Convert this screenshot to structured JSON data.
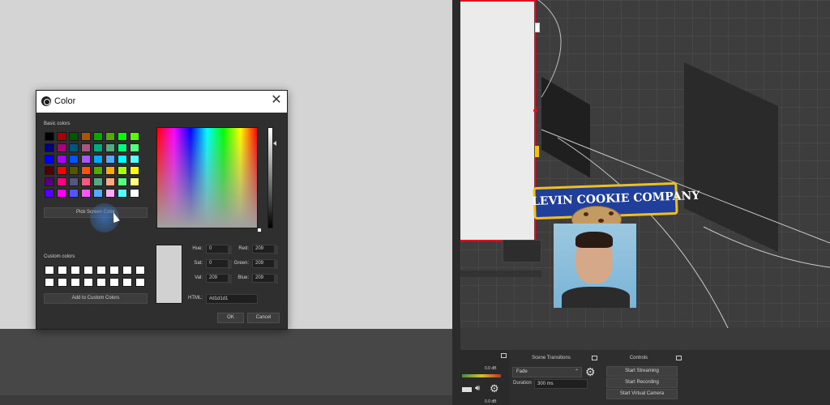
{
  "dialog": {
    "title": "Color",
    "close_glyph": "✕",
    "basic_colors_label": "Basic colors",
    "pick_screen_color_label": "Pick Screen Color",
    "custom_colors_label": "Custom colors",
    "add_to_custom_label": "Add to Custom Colors",
    "fields": {
      "hue_label": "Hue:",
      "hue_value": "0",
      "sat_label": "Sat:",
      "sat_value": "0",
      "val_label": "Val:",
      "val_value": "209",
      "red_label": "Red:",
      "red_value": "209",
      "green_label": "Green:",
      "green_value": "209",
      "blue_label": "Blue:",
      "blue_value": "209",
      "html_label": "HTML:",
      "html_value": "#d1d1d1"
    },
    "ok_label": "OK",
    "cancel_label": "Cancel",
    "current_color": "#d1d1d1",
    "basic_colors": [
      "#000000",
      "#aa0000",
      "#005500",
      "#aa5500",
      "#00aa00",
      "#55aa00",
      "#00ff00",
      "#55ff00",
      "#00007f",
      "#aa007f",
      "#00557f",
      "#aa557f",
      "#00aa7f",
      "#55aa7f",
      "#00ff7f",
      "#55ff7f",
      "#0000ff",
      "#aa00ff",
      "#0055ff",
      "#aa55ff",
      "#00aaff",
      "#55aaff",
      "#00ffff",
      "#55ffff",
      "#550000",
      "#ff0000",
      "#555500",
      "#ff5500",
      "#55aa00",
      "#ffaa00",
      "#aaff00",
      "#ffff00",
      "#55007f",
      "#ff007f",
      "#55557f",
      "#ff557f",
      "#55aa7f",
      "#ffaa7f",
      "#55ff7f",
      "#ffff7f",
      "#5500ff",
      "#ff00ff",
      "#5555ff",
      "#ff55ff",
      "#55aaff",
      "#ffaaff",
      "#55ffff",
      "#ffffff"
    ]
  },
  "preview": {
    "banner_text": "LEVIN COOKIE COMPANY"
  },
  "panels": {
    "scene_transitions_label": "Scene Transitions",
    "controls_label": "Controls",
    "transition_value": "Fade",
    "duration_label": "Duration",
    "duration_value": "300 ms",
    "start_streaming_label": "Start Streaming",
    "start_recording_label": "Start Recording",
    "start_virtual_camera_label": "Start Virtual Camera",
    "meter_db_top": "0.0 dB",
    "meter_db_bottom": "0.0 dB"
  },
  "colors": {
    "banner_blue": "#1f3f9a",
    "banner_gold": "#f0c020",
    "selection_red": "#e01020"
  }
}
